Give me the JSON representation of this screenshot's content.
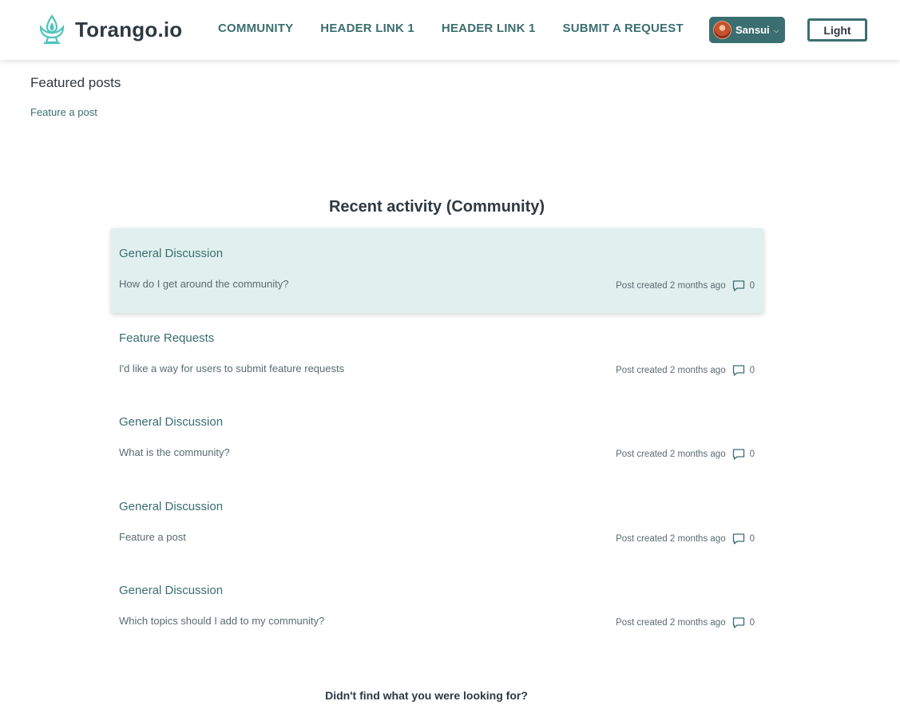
{
  "brand": {
    "name": "Torango.io",
    "icon": "lotus-lamp-icon",
    "accent_color": "#3b6e70",
    "icon_color": "#4ec3c0"
  },
  "nav": {
    "items": [
      {
        "label": "COMMUNITY"
      },
      {
        "label": "HEADER LINK 1"
      },
      {
        "label": "HEADER LINK 1"
      },
      {
        "label": "SUBMIT A REQUEST"
      }
    ]
  },
  "user": {
    "name": "Sansui",
    "avatar_icon": "user-avatar",
    "dropdown_icon": "chevron-down-icon"
  },
  "theme_toggle": {
    "label": "Light"
  },
  "featured": {
    "title": "Featured posts",
    "link": "Feature a post"
  },
  "activity": {
    "title": "Recent activity (Community)",
    "hover_bg": "#e1f0ef",
    "items": [
      {
        "category": "General Discussion",
        "title": "How do I get around the community?",
        "meta": "Post created 2 months ago",
        "comments": "0"
      },
      {
        "category": "Feature Requests",
        "title": "I'd like a way for users to submit feature requests",
        "meta": "Post created 2 months ago",
        "comments": "0"
      },
      {
        "category": "General Discussion",
        "title": "What is the community?",
        "meta": "Post created 2 months ago",
        "comments": "0"
      },
      {
        "category": "General Discussion",
        "title": "Feature a post",
        "meta": "Post created 2 months ago",
        "comments": "0"
      },
      {
        "category": "General Discussion",
        "title": "Which topics should I add to my community?",
        "meta": "Post created 2 months ago",
        "comments": "0"
      }
    ]
  },
  "footer": {
    "prompt": "Didn't find what you were looking for?"
  }
}
